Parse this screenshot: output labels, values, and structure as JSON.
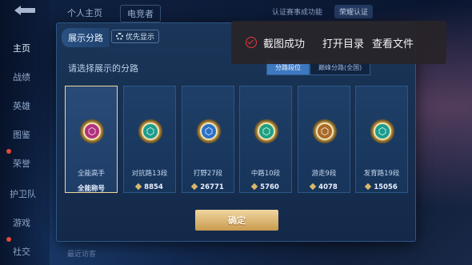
{
  "nav": {
    "items": [
      "主页",
      "战绩",
      "英雄",
      "图鉴",
      "荣誉",
      "护卫队",
      "游戏",
      "社交"
    ]
  },
  "background": {
    "tab_profile": "个人主页",
    "tab_other": "电竞者",
    "right_text": "认证赛事成功能",
    "right_btn": "荣耀认证",
    "bottom_text": "最近访客"
  },
  "dialog": {
    "title": "展示分路",
    "priority_btn": "优先显示",
    "subtitle": "请选择展示的分路",
    "seg_tabs": [
      "分路段位",
      "巅峰分路(全国)"
    ],
    "confirm": "确定",
    "cards": [
      {
        "label": "全能高手",
        "score": "全能称号",
        "icon": "all-round-icon",
        "color": "#b0307e",
        "selected": true,
        "show_score_icon": false
      },
      {
        "label": "对抗路13段",
        "score": "8854",
        "icon": "clash-lane-icon",
        "color": "#1a9c8e",
        "selected": false,
        "show_score_icon": true
      },
      {
        "label": "打野27段",
        "score": "26771",
        "icon": "jungle-icon",
        "color": "#2a70c8",
        "selected": false,
        "show_score_icon": true
      },
      {
        "label": "中路10段",
        "score": "5760",
        "icon": "mid-lane-icon",
        "color": "#1fa083",
        "selected": false,
        "show_score_icon": true
      },
      {
        "label": "游走9段",
        "score": "4078",
        "icon": "roam-icon",
        "color": "#a86a2a",
        "selected": false,
        "show_score_icon": true
      },
      {
        "label": "发育路19段",
        "score": "15056",
        "icon": "farm-lane-icon",
        "color": "#1a9c8e",
        "selected": false,
        "show_score_icon": true
      }
    ]
  },
  "toast": {
    "message": "截图成功",
    "open_dir": "打开目录",
    "view_file": "查看文件"
  }
}
